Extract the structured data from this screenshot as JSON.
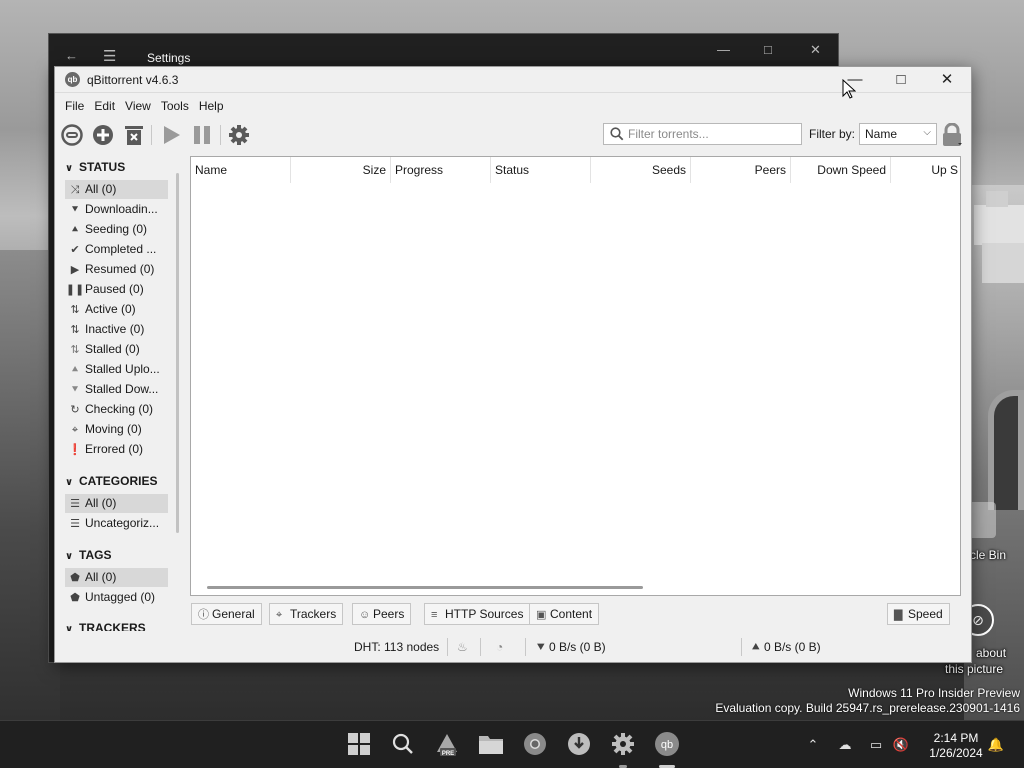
{
  "settings_window": {
    "title": "Settings"
  },
  "qbittorrent": {
    "title": "qBittorrent v4.6.3",
    "logo_text": "qb",
    "menu": [
      "File",
      "Edit",
      "View",
      "Tools",
      "Help"
    ],
    "toolbar": {
      "filter_placeholder": "Filter torrents...",
      "filter_by_label": "Filter by:",
      "filter_by_value": "Name"
    },
    "sidebar": {
      "status_header": "STATUS",
      "status_items": [
        {
          "label": "All (0)",
          "icon": "shuffle-icon",
          "selected": true
        },
        {
          "label": "Downloadin...",
          "icon": "download-icon"
        },
        {
          "label": "Seeding (0)",
          "icon": "upload-icon"
        },
        {
          "label": "Completed ...",
          "icon": "check-icon"
        },
        {
          "label": "Resumed (0)",
          "icon": "play-icon"
        },
        {
          "label": "Paused (0)",
          "icon": "pause-icon"
        },
        {
          "label": "Active (0)",
          "icon": "updown-icon"
        },
        {
          "label": "Inactive (0)",
          "icon": "updown-icon"
        },
        {
          "label": "Stalled (0)",
          "icon": "updown-icon"
        },
        {
          "label": "Stalled Uplo...",
          "icon": "stalled-upload-icon"
        },
        {
          "label": "Stalled Dow...",
          "icon": "stalled-download-icon"
        },
        {
          "label": "Checking (0)",
          "icon": "refresh-icon"
        },
        {
          "label": "Moving (0)",
          "icon": "crosshair-icon"
        },
        {
          "label": "Errored (0)",
          "icon": "error-icon"
        }
      ],
      "categories_header": "CATEGORIES",
      "category_items": [
        {
          "label": "All (0)",
          "icon": "list-icon",
          "selected": true
        },
        {
          "label": "Uncategoriz...",
          "icon": "list-icon"
        }
      ],
      "tags_header": "TAGS",
      "tag_items": [
        {
          "label": "All (0)",
          "icon": "tag-icon",
          "selected": true
        },
        {
          "label": "Untagged (0)",
          "icon": "tag-icon"
        }
      ],
      "trackers_header": "TRACKERS"
    },
    "table": {
      "columns": [
        "Name",
        "Size",
        "Progress",
        "Status",
        "Seeds",
        "Peers",
        "Down Speed",
        "Up S"
      ]
    },
    "tabs": [
      "General",
      "Trackers",
      "Peers",
      "HTTP Sources",
      "Content"
    ],
    "speed_tab": "Speed",
    "statusbar": {
      "dht": "DHT: 113 nodes",
      "download": "0 B/s (0 B)",
      "upload": "0 B/s (0 B)"
    }
  },
  "desktop": {
    "recycle_bin_label": "cle Bin",
    "about_label_1": "about",
    "about_label_2": "this picture",
    "watermark_1": "Windows 11 Pro Insider Preview",
    "watermark_2": "Evaluation copy. Build 25947.rs_prerelease.230901-1416"
  },
  "taskbar": {
    "time": "2:14 PM",
    "date": "1/26/2024",
    "apps": [
      "start-icon",
      "search-icon",
      "edge-canary-icon",
      "file-explorer-icon",
      "chrome-icon",
      "qbittorrent-installer-icon",
      "settings-icon",
      "qbittorrent-icon"
    ],
    "pre_badge": "PRE"
  }
}
